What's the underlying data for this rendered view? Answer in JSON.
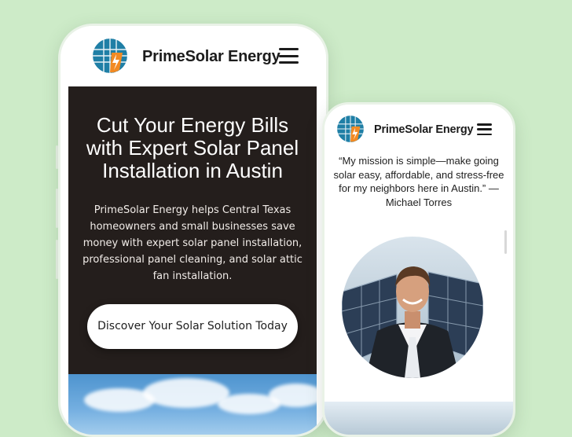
{
  "brand": {
    "name": "PrimeSolar Energy"
  },
  "colors": {
    "background": "#cdebc8",
    "hero_bg": "#241e1c",
    "logo_blue": "#1f7fa6",
    "logo_orange": "#f28a23"
  },
  "icons": {
    "logo": "solar-globe-bolt-icon",
    "menu": "hamburger-menu-icon"
  },
  "hero": {
    "title": "Cut Your Energy Bills with Expert Solar Panel Installation in Austin",
    "description": "PrimeSolar Energy helps Central Texas homeowners and small businesses save money with expert solar panel installation, professional panel cleaning, and solar attic fan installation.",
    "cta_label": "Discover Your Solar Solution Today"
  },
  "about": {
    "quote": "“My mission is simple—make going solar easy, affordable, and stress-free for my neighbors here in Austin.” — Michael Torres"
  }
}
